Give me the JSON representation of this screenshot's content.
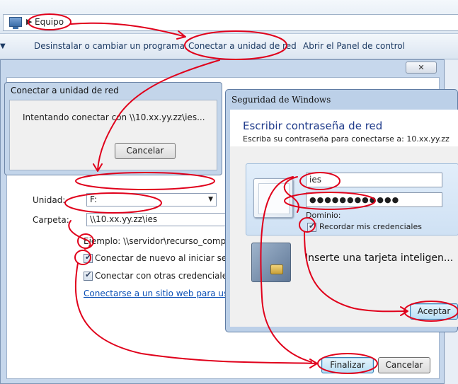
{
  "explorer": {
    "address": "Equipo",
    "commands": {
      "uninstall": "Desinstalar o cambiar un programa",
      "map_drive": "Conectar a unidad de red",
      "control_panel": "Abrir el Panel de control"
    }
  },
  "wizard": {
    "close_glyph": "✕",
    "drive_label": "Unidad:",
    "drive_value": "F:",
    "folder_label": "Carpeta:",
    "folder_value": "\\\\10.xx.yy.zz\\ies",
    "example": "Ejemplo: \\\\servidor\\recurso_comparti",
    "reconnect_label": "Conectar de nuevo al iniciar sesión",
    "other_creds_label": "Conectar con otras credenciales",
    "website_link": "Conectarse a un sitio web para usarlo c",
    "finish_button": "Finalizar",
    "cancel_button": "Cancelar"
  },
  "connecting": {
    "title": "Conectar a unidad de red",
    "message": "Intentando conectar con \\\\10.xx.yy.zz\\ies...",
    "cancel_button": "Cancelar"
  },
  "security": {
    "title": "Seguridad de Windows",
    "heading": "Escribir contraseña de red",
    "subtitle": "Escriba su contraseña para conectarse a: 10.xx.yy.zz",
    "username": "ies",
    "password_mask": "●●●●●●●●●●●●",
    "domain_label": "Dominio:",
    "remember_label": "Recordar mis credenciales",
    "smartcard_label": "Inserte una tarjeta inteligen...",
    "accept_button": "Aceptar"
  },
  "colors": {
    "annotation": "#e0001b",
    "link": "#0a4fb5",
    "heading": "#1e3a8a"
  }
}
